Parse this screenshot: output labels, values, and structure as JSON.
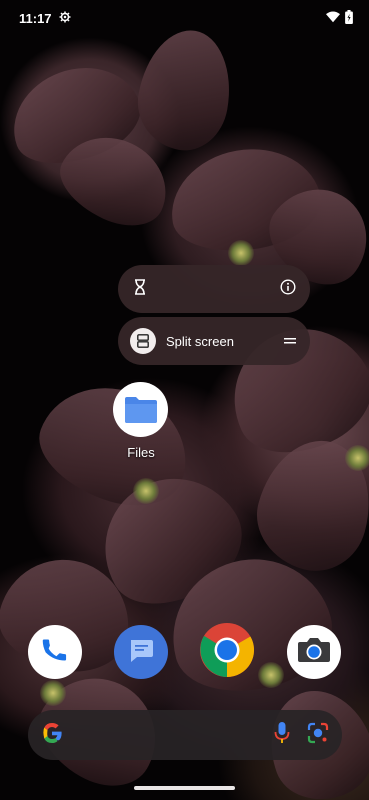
{
  "status_bar": {
    "time": "11:17",
    "icons": [
      "settings-gear-icon",
      "wifi-icon",
      "battery-charging-icon"
    ]
  },
  "shortcut_menu": {
    "app_info_icon": "info-icon",
    "timer_icon": "hourglass-icon",
    "split_screen_label": "Split screen",
    "split_screen_icon": "split-screen-icon",
    "drag_handle_icon": "drag-handle-icon"
  },
  "home": {
    "apps": [
      {
        "label": "Files",
        "icon": "folder-icon",
        "color": "#4a86e8"
      }
    ]
  },
  "dock": {
    "apps": [
      {
        "name": "Phone",
        "icon": "phone-icon"
      },
      {
        "name": "Messages",
        "icon": "messages-icon"
      },
      {
        "name": "Chrome",
        "icon": "chrome-icon"
      },
      {
        "name": "Camera",
        "icon": "camera-icon"
      }
    ]
  },
  "search_bar": {
    "left_icon": "google-g-icon",
    "right_icons": [
      "microphone-icon",
      "google-lens-icon"
    ]
  },
  "colors": {
    "accent_blue": "#1a73e8",
    "menu_bg": "#362628",
    "search_bg": "#282426"
  }
}
